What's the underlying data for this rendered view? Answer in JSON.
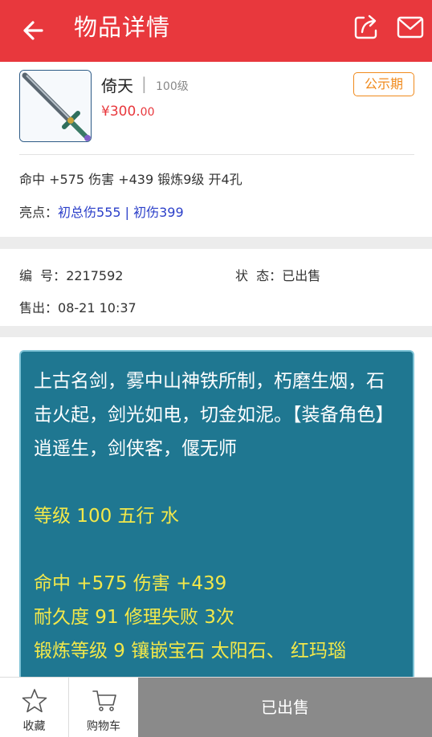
{
  "header": {
    "title": "物品详情"
  },
  "item": {
    "name": "倚天",
    "separator": "|",
    "level": "100级",
    "price_main": "¥300.",
    "price_cents": "00",
    "badge": "公示期",
    "stats_line": "命中 +575 伤害 +439 锻炼9级 开4孔",
    "highlight_label": "亮点：",
    "highlight_value": "初总伤555 | 初伤399"
  },
  "info": {
    "id_label": "编  号：",
    "id_value": "2217592",
    "status_label": "状  态：",
    "status_value": "已出售",
    "sold_label": "售出：",
    "sold_value": "08-21 10:37"
  },
  "description": {
    "intro": "上古名剑，雾中山神铁所制，朽磨生烟，石击火起，剑光如电，切金如泥。【装备角色】逍遥生，剑侠客，偃无师",
    "level_line": "等级 100 五行 水",
    "attr_line1": "命中 +575 伤害 +439",
    "attr_line2": "耐久度 91 修理失败 3次",
    "attr_line3": "锻炼等级 9 镶嵌宝石 太阳石、 红玛瑙"
  },
  "bottom_bar": {
    "favorite_label": "收藏",
    "cart_label": "购物车",
    "sold_label": "已出售"
  },
  "colors": {
    "header_bg": "#e8383d",
    "badge": "#f08a1c",
    "price": "#e8383d",
    "highlight_link": "#2b3fc9",
    "desc_bg": "#1f7791",
    "desc_yellow": "#f3e84a",
    "sold_button_bg": "#8a8a8a"
  },
  "icons": {
    "back": "arrow-left-icon",
    "share": "share-icon",
    "message": "mail-icon",
    "favorite": "star-icon",
    "cart": "cart-icon"
  }
}
